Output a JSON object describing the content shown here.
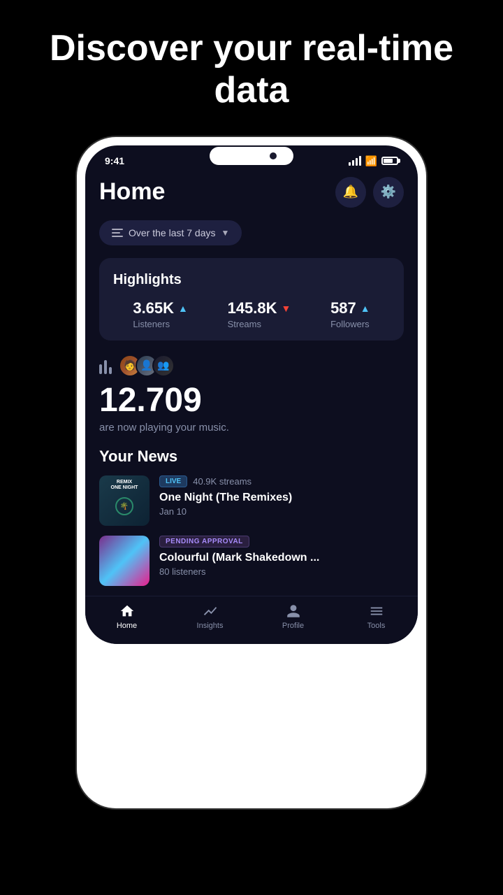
{
  "hero": {
    "title": "Discover your real-time data"
  },
  "status_bar": {
    "time": "9:41"
  },
  "header": {
    "title": "Home"
  },
  "filter": {
    "label": "Over the last 7 days"
  },
  "highlights": {
    "title": "Highlights",
    "stats": [
      {
        "value": "3.65K",
        "direction": "up",
        "label": "Listeners"
      },
      {
        "value": "145.8K",
        "direction": "down",
        "label": "Streams"
      },
      {
        "value": "587",
        "direction": "up",
        "label": "Followers"
      }
    ]
  },
  "now_playing": {
    "count": "12.709",
    "text": "are now playing your music."
  },
  "your_news": {
    "title": "Your News",
    "items": [
      {
        "badge_type": "live",
        "badge_label": "LIVE",
        "meta": "40.9K streams",
        "title": "One Night (The Remixes)",
        "sub": "Jan 10"
      },
      {
        "badge_type": "pending",
        "badge_label": "PENDING APPROVAL",
        "meta": "",
        "title": "Colourful (Mark Shakedown ...",
        "sub": "80 listeners"
      }
    ]
  },
  "nav": {
    "items": [
      {
        "label": "Home",
        "active": true
      },
      {
        "label": "Insights",
        "active": false
      },
      {
        "label": "Profile",
        "active": false
      },
      {
        "label": "Tools",
        "active": false
      }
    ]
  }
}
